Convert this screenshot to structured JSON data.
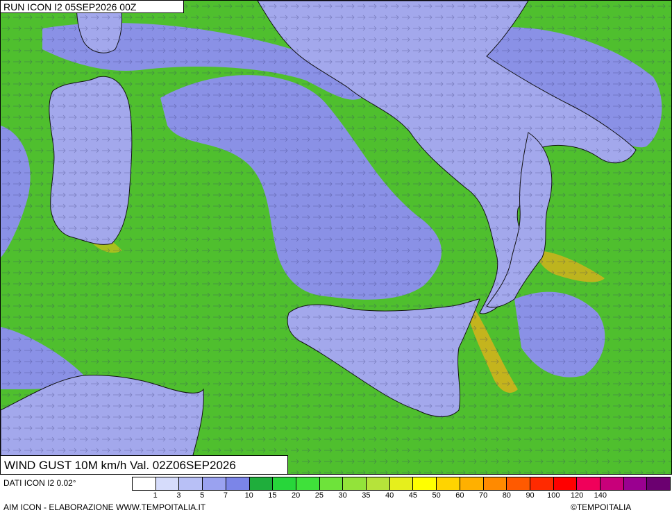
{
  "header": {
    "run_title": "RUN ICON I2 05SEP2026 00Z"
  },
  "map": {
    "product_title": "WIND GUST 10M km/h Val. 02Z06SEP2026",
    "ocean_color": "#8a91e6",
    "land_color": "#4fbf2e",
    "coast_color": "#111111"
  },
  "legend": {
    "colors": [
      "#ffffff",
      "#d6dcfb",
      "#b8c0f6",
      "#9aa2f0",
      "#7b85e8",
      "#1fae3c",
      "#27d63a",
      "#3fe13a",
      "#6ee33a",
      "#93e33a",
      "#b6e33a",
      "#e6ef1c",
      "#ffff00",
      "#ffd400",
      "#ffb000",
      "#ff8a00",
      "#ff5a00",
      "#ff2a00",
      "#ff0000",
      "#f0005a",
      "#c8007a",
      "#9a0090",
      "#6b0070"
    ],
    "ticks": [
      "1",
      "3",
      "5",
      "7",
      "10",
      "15",
      "20",
      "25",
      "30",
      "35",
      "40",
      "45",
      "50",
      "60",
      "70",
      "80",
      "90",
      "100",
      "120",
      "140"
    ]
  },
  "footer": {
    "data_source": "DATI ICON I2 0.02°",
    "credit": "AIM ICON - ELABORAZIONE WWW.TEMPOITALIA.IT",
    "copyright": "©TEMPOITALIA"
  }
}
